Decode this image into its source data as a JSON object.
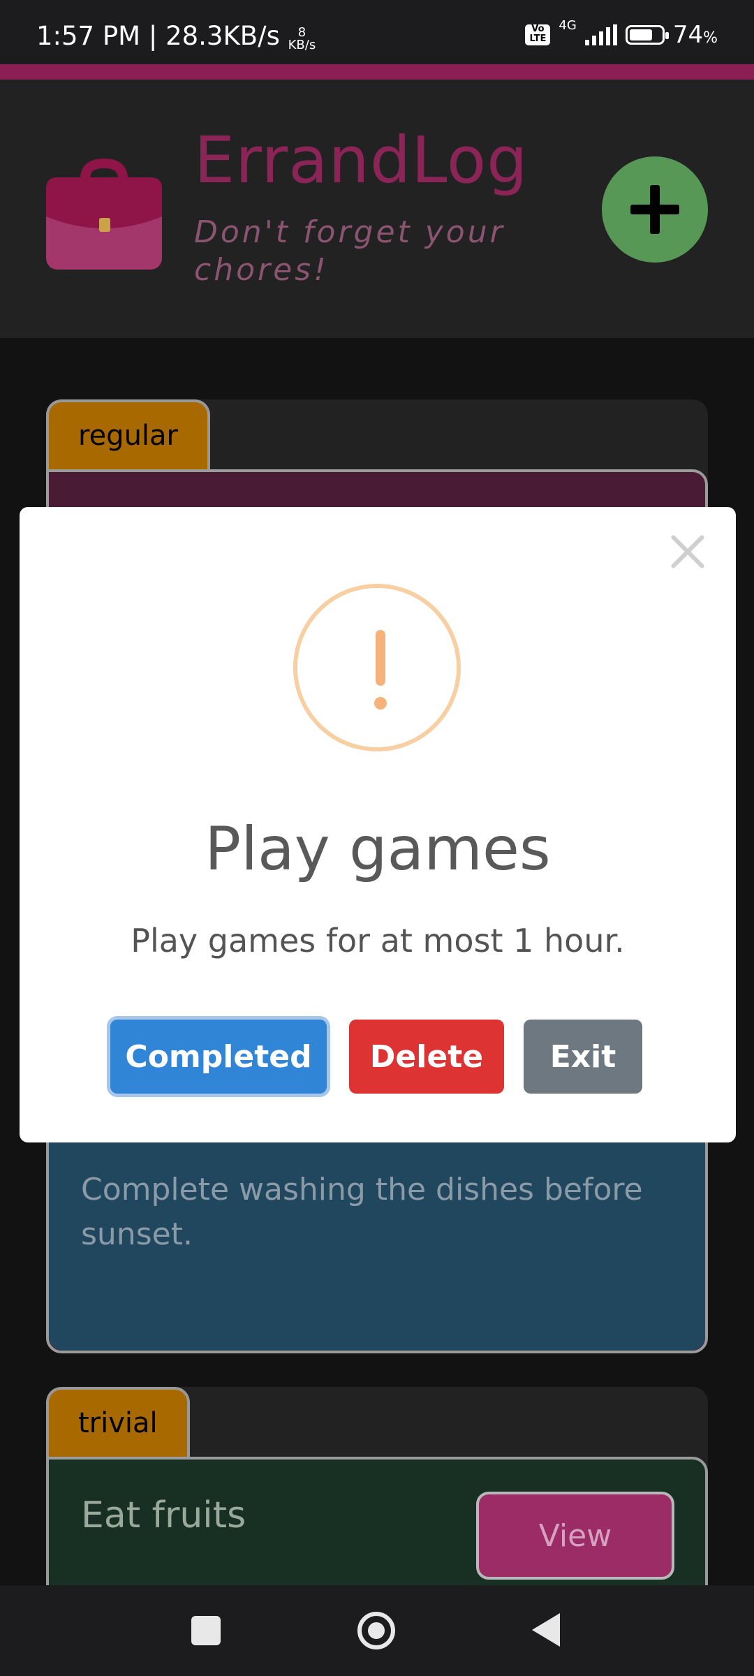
{
  "status_bar": {
    "time_speed": "1:57 PM | 28.3KB/s",
    "kbs_value": "8",
    "kbs_unit": "KB/s",
    "volte": "Vo LTE",
    "network": "4G",
    "battery_percent": "74",
    "battery_unit": "%",
    "battery_level": 0.74
  },
  "header": {
    "app_title": "ErrandLog",
    "subtitle": "Don't forget your chores!",
    "add_button_label": "+"
  },
  "cards": [
    {
      "tag": "regular",
      "description": "Complete washing the dishes before sunset."
    },
    {
      "tag": "trivial",
      "title": "Eat fruits",
      "view_label": "View"
    }
  ],
  "modal": {
    "title": "Play games",
    "text": "Play games for at most 1 hour.",
    "buttons": {
      "completed": "Completed",
      "delete": "Delete",
      "exit": "Exit"
    }
  },
  "colors": {
    "accent": "#8b1e52",
    "fab": "#579856",
    "completed": "#3085d6",
    "delete": "#dd3333",
    "exit": "#6e7881"
  }
}
